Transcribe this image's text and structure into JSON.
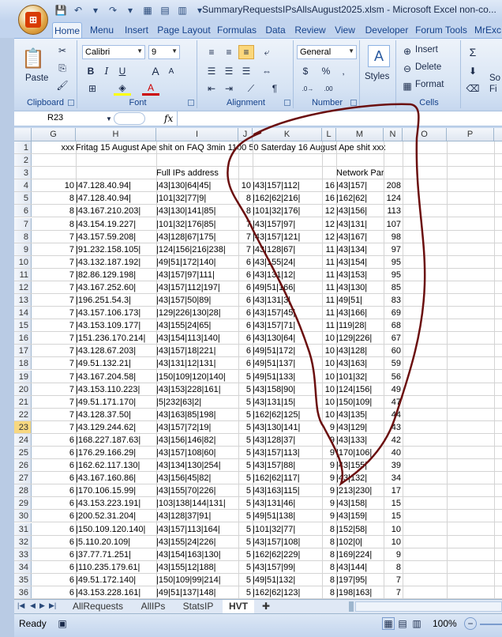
{
  "window": {
    "title": "SummaryRequestsIPsAllsAugust2025.xlsm - Microsoft Excel non-co..."
  },
  "ribbon_tabs": [
    "Home",
    "Menu",
    "Insert",
    "Page Layout",
    "Formulas",
    "Data",
    "Review",
    "View",
    "Developer",
    "Forum Tools",
    "MrExc"
  ],
  "active_tab": "Home",
  "ribbon": {
    "clipboard": {
      "label": "Clipboard",
      "paste": "Paste"
    },
    "font": {
      "label": "Font",
      "name": "Calibri",
      "size": "9",
      "bold": "B",
      "italic": "I",
      "underline": "U",
      "grow": "A",
      "shrink": "A"
    },
    "alignment": {
      "label": "Alignment"
    },
    "number": {
      "label": "Number",
      "format": "General",
      "currency": "$",
      "percent": "%",
      "comma": ","
    },
    "styles": {
      "label": "Styles"
    },
    "cells": {
      "label": "Cells",
      "insert": "Insert",
      "delete": "Delete",
      "format": "Format"
    },
    "editing": {
      "sigma": "Σ",
      "sort": "So",
      "fi": "Fi"
    }
  },
  "formula_bar": {
    "name_box": "R23",
    "fx": "fx",
    "formula": ""
  },
  "grid": {
    "columns": [
      "G",
      "H",
      "I",
      "J",
      "K",
      "L",
      "M",
      "N",
      "O",
      "P"
    ],
    "active_row": 23,
    "rows": [
      {
        "n": 1,
        "G": "xxx",
        "H": "Fritag 15 August  Ape shit on FAQ 3min  1100 50 Saterday 16 August   Ape shit xxx",
        "I": "",
        "J": "",
        "K": "",
        "L": "",
        "M": "",
        "N": ""
      },
      {
        "n": 2,
        "G": "",
        "H": "",
        "I": "",
        "J": "",
        "K": "",
        "L": "",
        "M": "",
        "N": ""
      },
      {
        "n": 3,
        "G": "",
        "H": "",
        "I": "Full IPs address",
        "J": "",
        "K": "",
        "L": "",
        "M": "Network Part",
        "N": ""
      },
      {
        "n": 4,
        "G": "10",
        "H": "|47.128.40.94|",
        "I": "|43|130|64|45|",
        "J": "10",
        "K": "|43|157|112|",
        "L": "16",
        "M": "|43|157|",
        "N": "208"
      },
      {
        "n": 5,
        "G": "8",
        "H": "|47.128.40.94|",
        "I": "|101|32|77|9|",
        "J": "8",
        "K": "|162|62|216|",
        "L": "16",
        "M": "|162|62|",
        "N": "124"
      },
      {
        "n": 6,
        "G": "8",
        "H": "|43.167.210.203|",
        "I": "|43|130|141|85|",
        "J": "8",
        "K": "|101|32|176|",
        "L": "12",
        "M": "|43|156|",
        "N": "113"
      },
      {
        "n": 7,
        "G": "8",
        "H": "|43.154.19.227|",
        "I": "|101|32|176|85|",
        "J": "7",
        "K": "|43|157|97|",
        "L": "12",
        "M": "|43|131|",
        "N": "107"
      },
      {
        "n": 8,
        "G": "7",
        "H": "|43.157.59.208|",
        "I": "|43|128|67|175|",
        "J": "7",
        "K": "|43|157|121|",
        "L": "12",
        "M": "|43|167|",
        "N": "98"
      },
      {
        "n": 9,
        "G": "7",
        "H": "|91.232.158.105|",
        "I": "|124|156|216|238|",
        "J": "7",
        "K": "|43|128|67|",
        "L": "11",
        "M": "|43|134|",
        "N": "97"
      },
      {
        "n": 10,
        "G": "7",
        "H": "|43.132.187.192|",
        "I": "|49|51|172|140|",
        "J": "6",
        "K": "|43|155|24|",
        "L": "11",
        "M": "|43|154|",
        "N": "95"
      },
      {
        "n": 11,
        "G": "7",
        "H": "|82.86.129.198|",
        "I": "|43|157|97|111|",
        "J": "6",
        "K": "|43|131|12|",
        "L": "11",
        "M": "|43|153|",
        "N": "95"
      },
      {
        "n": 12,
        "G": "7",
        "H": "|43.167.252.60|",
        "I": "|43|157|112|197|",
        "J": "6",
        "K": "|49|51|166|",
        "L": "11",
        "M": "|43|130|",
        "N": "85"
      },
      {
        "n": 13,
        "G": "7",
        "H": "|196.251.54.3|",
        "I": "|43|157|50|89|",
        "J": "6",
        "K": "|43|131|3|",
        "L": "11",
        "M": "|49|51|",
        "N": "83"
      },
      {
        "n": 14,
        "G": "7",
        "H": "|43.157.106.173|",
        "I": "|129|226|130|28|",
        "J": "6",
        "K": "|43|157|45|",
        "L": "11",
        "M": "|43|166|",
        "N": "69"
      },
      {
        "n": 15,
        "G": "7",
        "H": "|43.153.109.177|",
        "I": "|43|155|24|65|",
        "J": "6",
        "K": "|43|157|71|",
        "L": "11",
        "M": "|119|28|",
        "N": "68"
      },
      {
        "n": 16,
        "G": "7",
        "H": "|151.236.170.214|",
        "I": "|43|154|113|140|",
        "J": "6",
        "K": "|43|130|64|",
        "L": "10",
        "M": "|129|226|",
        "N": "67"
      },
      {
        "n": 17,
        "G": "7",
        "H": "|43.128.67.203|",
        "I": "|43|157|18|221|",
        "J": "6",
        "K": "|49|51|172|",
        "L": "10",
        "M": "|43|128|",
        "N": "60"
      },
      {
        "n": 18,
        "G": "7",
        "H": "|49.51.132.21|",
        "I": "|43|131|12|131|",
        "J": "6",
        "K": "|49|51|137|",
        "L": "10",
        "M": "|43|163|",
        "N": "59"
      },
      {
        "n": 19,
        "G": "7",
        "H": "|43.167.204.58|",
        "I": "|150|109|120|140|",
        "J": "5",
        "K": "|49|51|133|",
        "L": "10",
        "M": "|101|32|",
        "N": "56"
      },
      {
        "n": 20,
        "G": "7",
        "H": "|43.153.110.223|",
        "I": "|43|153|228|161|",
        "J": "5",
        "K": "|43|158|90|",
        "L": "10",
        "M": "|124|156|",
        "N": "49"
      },
      {
        "n": 21,
        "G": "7",
        "H": "|49.51.171.170|",
        "I": "|5|232|63|2|",
        "J": "5",
        "K": "|43|131|15|",
        "L": "10",
        "M": "|150|109|",
        "N": "47"
      },
      {
        "n": 22,
        "G": "7",
        "H": "|43.128.37.50|",
        "I": "|43|163|85|198|",
        "J": "5",
        "K": "|162|62|125|",
        "L": "10",
        "M": "|43|135|",
        "N": "44"
      },
      {
        "n": 23,
        "G": "7",
        "H": "|43.129.244.62|",
        "I": "|43|157|72|19|",
        "J": "5",
        "K": "|43|130|141|",
        "L": "9",
        "M": "|43|129|",
        "N": "43"
      },
      {
        "n": 24,
        "G": "6",
        "H": "|168.227.187.63|",
        "I": "|43|156|146|82|",
        "J": "5",
        "K": "|43|128|37|",
        "L": "9",
        "M": "|43|133|",
        "N": "42"
      },
      {
        "n": 25,
        "G": "6",
        "H": "|176.29.166.29|",
        "I": "|43|157|108|60|",
        "J": "5",
        "K": "|43|157|113|",
        "L": "9",
        "M": "|170|106|",
        "N": "40"
      },
      {
        "n": 26,
        "G": "6",
        "H": "|162.62.117.130|",
        "I": "|43|134|130|254|",
        "J": "5",
        "K": "|43|157|88|",
        "L": "9",
        "M": "|43|155|",
        "N": "39"
      },
      {
        "n": 27,
        "G": "6",
        "H": "|43.167.160.86|",
        "I": "|43|156|45|82|",
        "J": "5",
        "K": "|162|62|117|",
        "L": "9",
        "M": "|43|132|",
        "N": "34"
      },
      {
        "n": 28,
        "G": "6",
        "H": "|170.106.15.99|",
        "I": "|43|155|70|226|",
        "J": "5",
        "K": "|43|163|115|",
        "L": "9",
        "M": "|213|230|",
        "N": "17"
      },
      {
        "n": 29,
        "G": "6",
        "H": "|43.153.223.191|",
        "I": "|103|138|144|131|",
        "J": "5",
        "K": "|43|131|46|",
        "L": "9",
        "M": "|43|158|",
        "N": "15"
      },
      {
        "n": 30,
        "G": "6",
        "H": "|200.52.31.204|",
        "I": "|43|128|37|91|",
        "J": "5",
        "K": "|49|51|138|",
        "L": "9",
        "M": "|43|159|",
        "N": "15"
      },
      {
        "n": 31,
        "G": "6",
        "H": "|150.109.120.140|",
        "I": "|43|157|113|164|",
        "J": "5",
        "K": "|101|32|77|",
        "L": "8",
        "M": "|152|58|",
        "N": "10"
      },
      {
        "n": 32,
        "G": "6",
        "H": "|5.110.20.109|",
        "I": "|43|155|24|226|",
        "J": "5",
        "K": "|43|157|108|",
        "L": "8",
        "M": "|102|0|",
        "N": "10"
      },
      {
        "n": 33,
        "G": "6",
        "H": "|37.77.71.251|",
        "I": "|43|154|163|130|",
        "J": "5",
        "K": "|162|62|229|",
        "L": "8",
        "M": "|169|224|",
        "N": "9"
      },
      {
        "n": 34,
        "G": "6",
        "H": "|110.235.179.61|",
        "I": "|43|155|12|188|",
        "J": "5",
        "K": "|43|157|99|",
        "L": "8",
        "M": "|43|144|",
        "N": "8"
      },
      {
        "n": 35,
        "G": "6",
        "H": "|49.51.172.140|",
        "I": "|150|109|99|214|",
        "J": "5",
        "K": "|49|51|132|",
        "L": "8",
        "M": "|197|95|",
        "N": "7"
      },
      {
        "n": 36,
        "G": "6",
        "H": "|43.153.228.161|",
        "I": "|49|51|137|148|",
        "J": "5",
        "K": "|162|62|123|",
        "L": "8",
        "M": "|198|163|",
        "N": "7"
      }
    ]
  },
  "sheets": [
    "AllRequests",
    "AllIPs",
    "StatsIP",
    "HVT"
  ],
  "active_sheet": "HVT",
  "status": {
    "ready": "Ready",
    "zoom": "100%"
  },
  "colors": {
    "annotation_stroke": "#6b0f0f",
    "selected_row_header": "#f8d880"
  }
}
